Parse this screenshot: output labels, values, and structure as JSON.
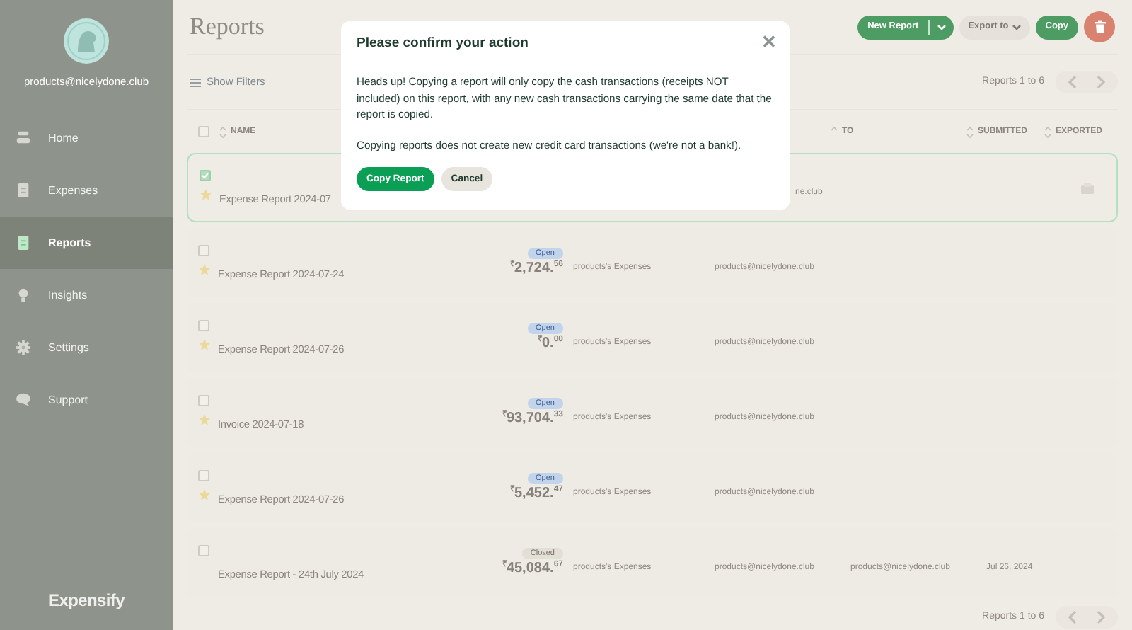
{
  "sidebar": {
    "email": "products@nicelydone.club",
    "items": [
      {
        "label": "Home",
        "kind": "home",
        "selected": false
      },
      {
        "label": "Expenses",
        "kind": "doc",
        "selected": false
      },
      {
        "label": "Reports",
        "kind": "doc",
        "selected": true
      },
      {
        "label": "Insights",
        "kind": "bulb",
        "selected": false
      },
      {
        "label": "Settings",
        "kind": "gear",
        "selected": false
      },
      {
        "label": "Support",
        "kind": "chat",
        "selected": false
      }
    ],
    "logo": "Expensify"
  },
  "page": {
    "title": "Reports",
    "filters": "Show Filters",
    "new_report": "New Report",
    "export": "Export to",
    "copy": "Copy",
    "range_top": "Reports 1 to 6",
    "range_bottom": "Reports 1 to 6"
  },
  "columns": [
    {
      "label": "NAME",
      "sorted": false,
      "select_all": false
    },
    {
      "label": "TO",
      "sorted": true
    },
    {
      "label": "SUBMITTED",
      "sorted": false
    },
    {
      "label": "EXPORTED",
      "sorted": false
    }
  ],
  "rows": [
    {
      "kind": "covered",
      "checked": true,
      "starred": true,
      "selected": true,
      "name": "Expense Report 2024-07",
      "from": "ne.club",
      "exported": true
    },
    {
      "kind": "row",
      "checked": false,
      "starred": true,
      "selected": false,
      "name": "Expense Report 2024-07-24",
      "status": {
        "label": "Open",
        "kind": "open"
      },
      "amount": "$^{₹}$2,724.$^{56}$",
      "policy": "products's Expenses",
      "from": "products@nicelydone.club",
      "exported": false
    },
    {
      "kind": "row",
      "checked": false,
      "starred": true,
      "selected": false,
      "name": "Expense Report 2024-07-26",
      "status": {
        "label": "Open",
        "kind": "open"
      },
      "amount": "$^{₹}$0.$^{00}$",
      "policy": "products's Expenses",
      "from": "products@nicelydone.club",
      "exported": false
    },
    {
      "kind": "row",
      "checked": false,
      "starred": true,
      "selected": false,
      "name": "Invoice 2024-07-18",
      "status": {
        "label": "Open",
        "kind": "open"
      },
      "amount": "$^{₹}$93,704.$^{33}$",
      "policy": "products's Expenses",
      "from": "products@nicelydone.club",
      "exported": false
    },
    {
      "kind": "row",
      "checked": false,
      "starred": true,
      "selected": false,
      "name": "Expense Report 2024-07-26",
      "status": {
        "label": "Open",
        "kind": "open"
      },
      "amount": "$^{₹}$5,452.$^{47}$",
      "policy": "products's Expenses",
      "from": "products@nicelydone.club",
      "exported": false
    },
    {
      "kind": "row",
      "checked": false,
      "starred": false,
      "selected": false,
      "name": "Expense Report - 24th July 2024",
      "status": {
        "label": "Closed",
        "kind": "closed"
      },
      "amount": "$^{₹}$45,084.$^{67}$",
      "policy": "products's Expenses",
      "from": "products@nicelydone.club",
      "to": "products@nicelydone.club",
      "submitted": "Jul 26, 2024",
      "exported": false
    }
  ],
  "dialog": {
    "title": "Please confirm your action",
    "close": "✕",
    "paragraphs": [
      "Heads up! Copying a report will only copy the cash transactions (receipts NOT included) on this report, with any new cash transactions carrying the same date that the report is copied.",
      "Copying reports does not create new credit card transactions (we're not a bank!)."
    ],
    "confirm": "Copy Report",
    "cancel": "Cancel"
  }
}
